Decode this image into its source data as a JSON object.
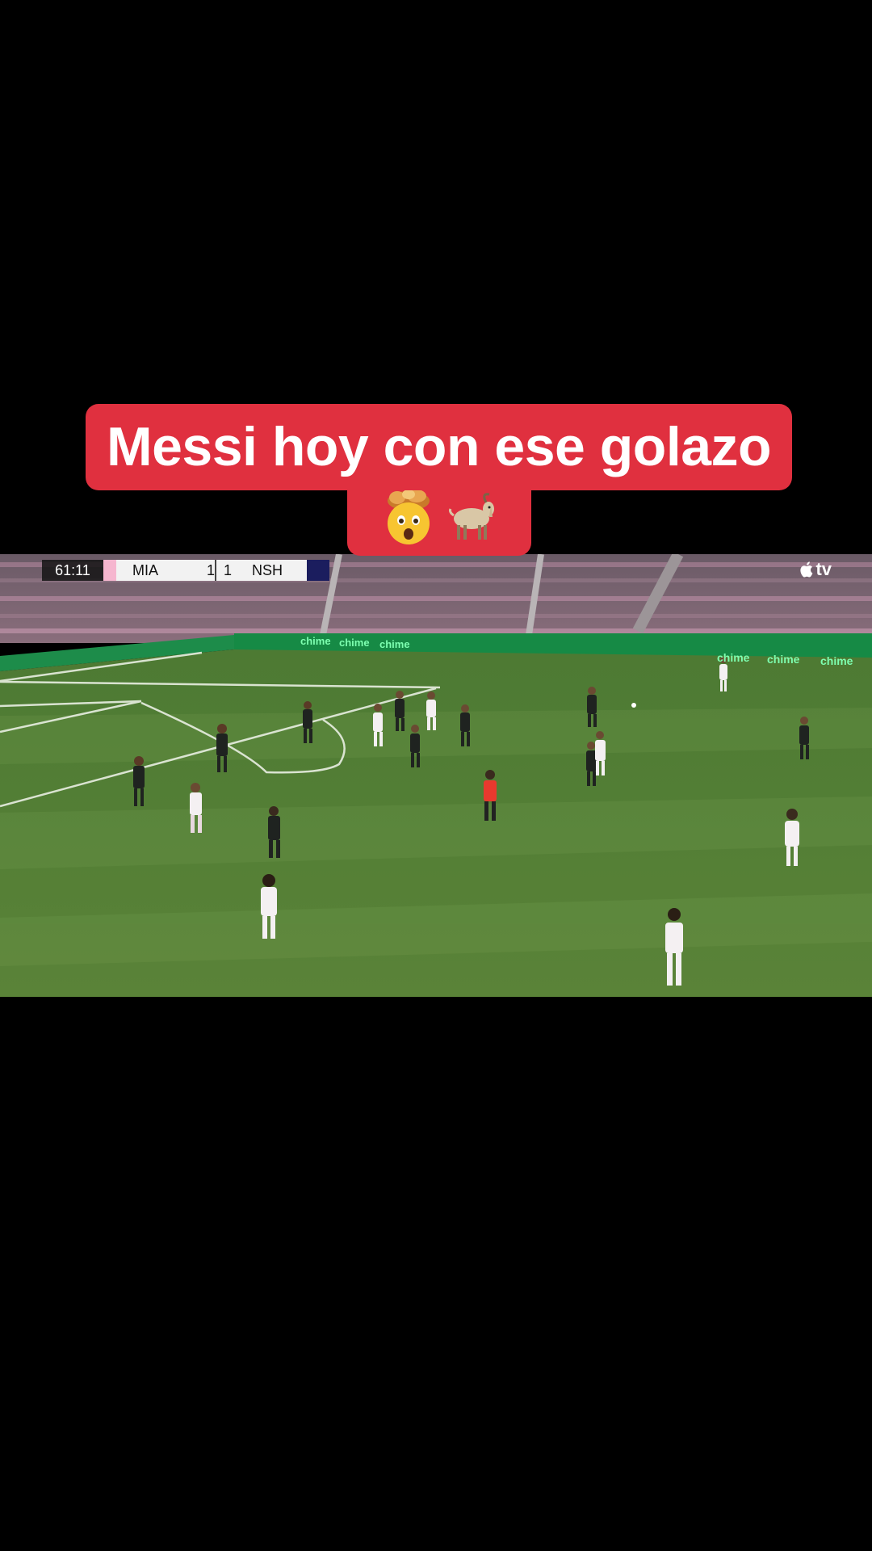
{
  "caption": {
    "line1": "Messi hoy con ese golazo",
    "emoji": "🤯🐐"
  },
  "scoreboard": {
    "clock": "61:11",
    "home_team": "MIA",
    "home_score": "1",
    "away_score": "1",
    "away_team": "NSH"
  },
  "broadcaster_logo": "tv",
  "ad_boards": [
    "chime",
    "chime",
    "chime",
    "chime",
    "chime",
    "chime"
  ],
  "colors": {
    "caption_bg": "#e0303f",
    "pitch": "#4f7a35",
    "home_kit": "#f4f0f2",
    "away_kit": "#1f2320",
    "referee": "#e8392e"
  }
}
